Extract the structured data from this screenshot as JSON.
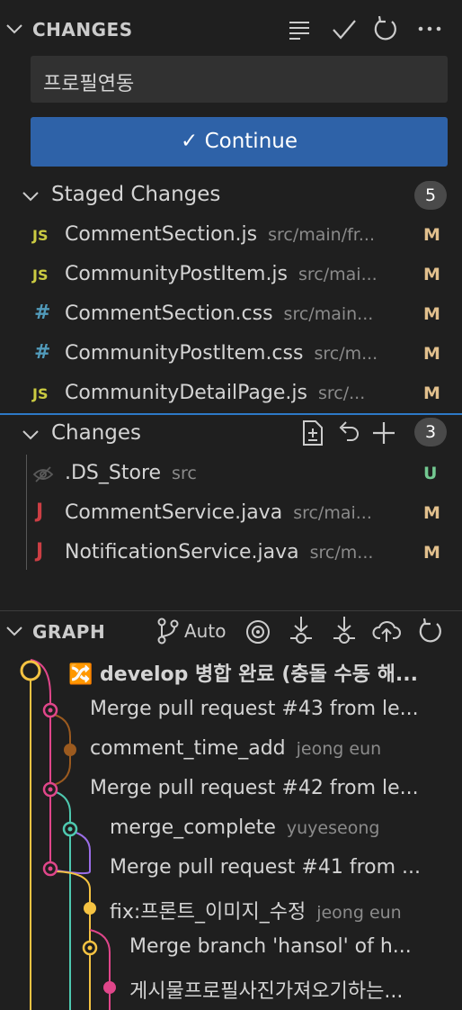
{
  "changes_section": {
    "title": "CHANGES",
    "commit_message": "프로필연동",
    "continue_label": "Continue",
    "check_glyph": "✓"
  },
  "staged": {
    "label": "Staged Changes",
    "count": "5",
    "files": [
      {
        "icon": "JS",
        "name": "CommentSection.js",
        "path": "src/main/fr...",
        "status": "M"
      },
      {
        "icon": "JS",
        "name": "CommunityPostItem.js",
        "path": "src/mai...",
        "status": "M"
      },
      {
        "icon": "#",
        "name": "CommentSection.css",
        "path": "src/main...",
        "status": "M"
      },
      {
        "icon": "#",
        "name": "CommunityPostItem.css",
        "path": "src/m...",
        "status": "M"
      },
      {
        "icon": "JS",
        "name": "CommunityDetailPage.js",
        "path": "src/...",
        "status": "M"
      }
    ]
  },
  "changes": {
    "label": "Changes",
    "count": "3",
    "files": [
      {
        "icon": "eye-off",
        "name": ".DS_Store",
        "path": "src",
        "status": "U"
      },
      {
        "icon": "J",
        "name": "CommentService.java",
        "path": "src/mai...",
        "status": "M"
      },
      {
        "icon": "J",
        "name": "NotificationService.java",
        "path": "src/m...",
        "status": "M"
      }
    ]
  },
  "graph": {
    "title": "GRAPH",
    "auto_label": "Auto",
    "commits": [
      {
        "message": "🔀 develop 병합 완료 (충돌 수동 해...",
        "author": ""
      },
      {
        "message": "Merge pull request #43 from le...",
        "author": ""
      },
      {
        "message": "comment_time_add",
        "author": "jeong eun"
      },
      {
        "message": "Merge pull request #42 from le...",
        "author": ""
      },
      {
        "message": "merge_complete",
        "author": "yuyeseong"
      },
      {
        "message": "Merge pull request #41 from ...",
        "author": ""
      },
      {
        "message": "fix:프론트_이미지_수정",
        "author": "jeong eun"
      },
      {
        "message": "Merge branch 'hansol' of h...",
        "author": ""
      },
      {
        "message": "게시물프로필사진가져오기하는...",
        "author": ""
      }
    ]
  },
  "colors": {
    "modified": "#e2c08d",
    "untracked": "#73c991",
    "js": "#cbcb41",
    "css": "#519aba",
    "java": "#cc3e44",
    "button": "#2e62a8",
    "graph_yellow": "#f5c342",
    "graph_pink": "#e0468a",
    "graph_teal": "#4ec9b0",
    "graph_brown": "#9b5a1f",
    "graph_purple": "#9b6ee8"
  }
}
